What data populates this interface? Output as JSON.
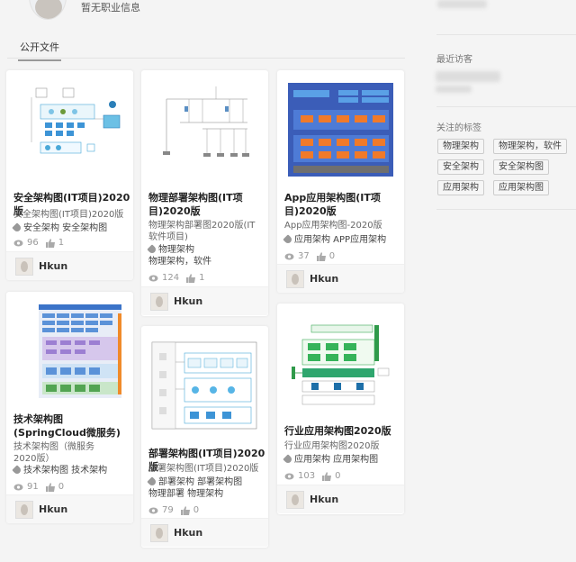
{
  "profile": {
    "job_info": "暂无职业信息"
  },
  "tabs": {
    "public_files": "公开文件"
  },
  "sidebar": {
    "recent_visitors": "最近访客",
    "followed_tags": "关注的标签",
    "tags": [
      "物理架构",
      "物理架构，软件",
      "安全架构",
      "安全架构图",
      "应用架构",
      "应用架构图"
    ]
  },
  "cards": [
    {
      "title": "安全架构图(IT项目)2020版",
      "desc": "安全架构图(IT项目)2020版",
      "tags": "安全架构   安全架构图",
      "views": "96",
      "likes": "1",
      "author": "Hkun"
    },
    {
      "title": "物理部署架构图(IT项目)2020版",
      "desc": "物理架构部署图2020版(IT软件项目)",
      "tags": "物理架构",
      "tags2": "物理架构，软件",
      "views": "124",
      "likes": "1",
      "author": "Hkun"
    },
    {
      "title": "App应用架构图(IT项目)2020版",
      "desc": "App应用架构图-2020版",
      "tags": "应用架构   APP应用架构",
      "views": "37",
      "likes": "0",
      "author": "Hkun"
    },
    {
      "title": "技术架构图(SpringCloud微服务)",
      "desc": "技术架构图（微服务2020版）",
      "tags": "技术架构图   技术架构",
      "views": "91",
      "likes": "0",
      "author": "Hkun"
    },
    {
      "title": "部署架构图(IT项目)2020版",
      "desc": "部署架构图(IT项目)2020版",
      "tags": "部署架构   部署架构图",
      "tags2": "物理部署   物理架构",
      "views": "79",
      "likes": "0",
      "author": "Hkun"
    },
    {
      "title": "行业应用架构图2020版",
      "desc": "行业应用架构图2020版",
      "tags": "应用架构   应用架构图",
      "views": "103",
      "likes": "0",
      "author": "Hkun"
    }
  ]
}
